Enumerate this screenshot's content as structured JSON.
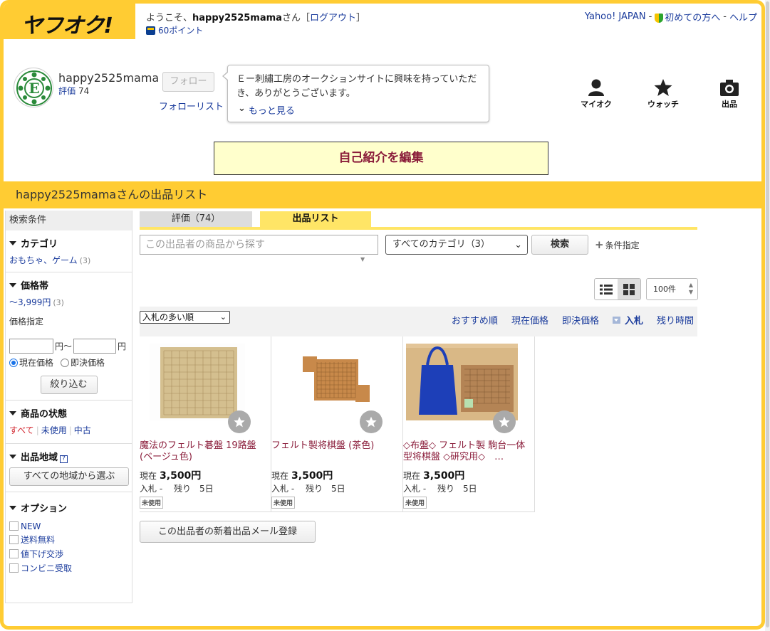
{
  "header": {
    "logo": "ヤフオク!",
    "welcome_prefix": "ようこそ、",
    "username": "happy2525mama",
    "welcome_suffix": "さん［",
    "logout": "ログアウト",
    "welcome_close": "］",
    "points": "60ポイント",
    "links": [
      "Yahoo! JAPAN",
      "-",
      "初めての方へ",
      "-",
      "ヘルプ"
    ]
  },
  "profile": {
    "name": "happy2525mama",
    "rating_label": "評価",
    "rating_value": "74",
    "follow_button": "フォロー",
    "follow_list": "フォローリスト",
    "bio": "Ｅー刺繡工房のオークションサイトに興味を持っていただき、ありがとうございます。",
    "more": "もっと見る"
  },
  "nav_icons": [
    {
      "label": "マイオク",
      "icon": "person-icon"
    },
    {
      "label": "ウォッチ",
      "icon": "star-icon"
    },
    {
      "label": "出品",
      "icon": "camera-icon"
    }
  ],
  "intro_button": "自己紹介を編集",
  "list_title": "happy2525mamaさんの出品リスト",
  "sidebar": {
    "header": "検索条件",
    "category_title": "カテゴリ",
    "category_item": "おもちゃ、ゲーム",
    "category_count": "(3)",
    "price_title": "価格帯",
    "price_range": "〜3,999円",
    "price_count": "(3)",
    "price_spec": "価格指定",
    "yen1": "円〜",
    "yen2": "円",
    "radio_current": "現在価格",
    "radio_buynow": "即決価格",
    "filter_button": "絞り込む",
    "condition_title": "商品の状態",
    "cond_all": "すべて",
    "cond_unused": "未使用",
    "cond_used": "中古",
    "region_title": "出品地域",
    "region_help": "?",
    "region_button": "すべての地域から選ぶ",
    "option_title": "オプション",
    "options": [
      "NEW",
      "送料無料",
      "値下げ交渉",
      "コンビニ受取"
    ]
  },
  "tabs": {
    "eval": "評価（74）",
    "listing": "出品リスト"
  },
  "search": {
    "placeholder": "この出品者の商品から探す",
    "category_select": "すべてのカテゴリ（3）",
    "button": "検索",
    "cond": "条件指定"
  },
  "per_page": "100件",
  "sort": {
    "select": "入札の多い順",
    "links": [
      "おすすめ順",
      "現在価格",
      "即決価格",
      "入札",
      "残り時間"
    ]
  },
  "items": [
    {
      "title": "魔法のフェルト碁盤 19路盤(ベージュ色)",
      "price_label": "現在",
      "price": "3,500円",
      "bids": "入札 -　 残り　5日",
      "badge": "未使用"
    },
    {
      "title": "フェルト製将棋盤 (茶色)",
      "price_label": "現在",
      "price": "3,500円",
      "bids": "入札 -　 残り　5日",
      "badge": "未使用"
    },
    {
      "title": "◇布盤◇ フェルト製 駒台一体型将棋盤 ◇研究用◇　…",
      "price_label": "現在",
      "price": "3,500円",
      "bids": "入札 -　 残り　5日",
      "badge": "未使用"
    }
  ],
  "mail_button": "この出品者の新着出品メール登録",
  "colors": {
    "accent": "#ffcc33",
    "link": "#1a3b9c",
    "item_title": "#8a1c3a"
  }
}
